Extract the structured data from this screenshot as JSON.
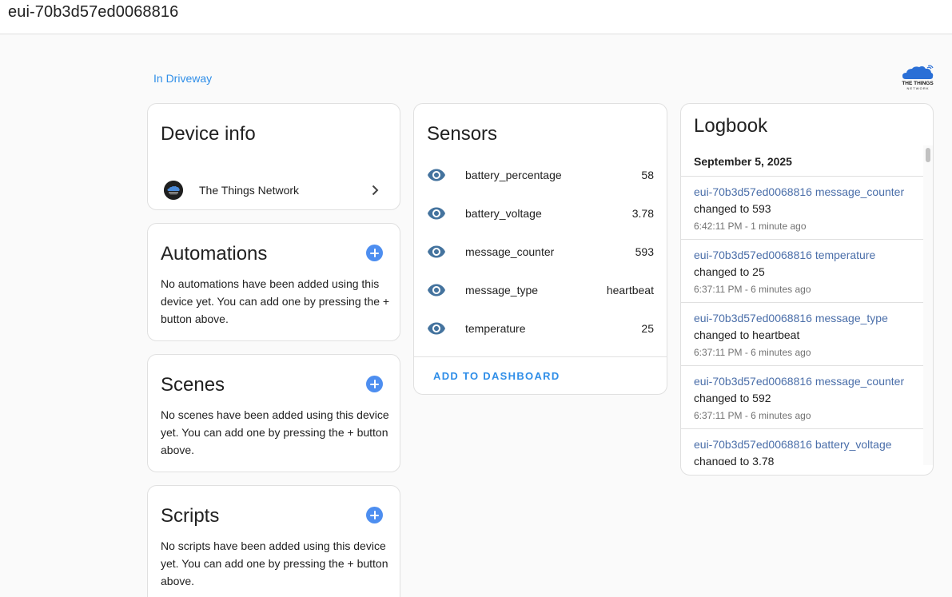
{
  "header": {
    "title": "eui-70b3d57ed0068816"
  },
  "area": {
    "label": "In Driveway"
  },
  "logo": {
    "lines": [
      "THE THINGS",
      "N E T W O R K"
    ],
    "color": "#2a6fd6"
  },
  "device_info": {
    "title": "Device info",
    "integration": "The Things Network"
  },
  "automations": {
    "title": "Automations",
    "text": "No automations have been added using this device yet. You can add one by pressing the + button above."
  },
  "scenes": {
    "title": "Scenes",
    "text": "No scenes have been added using this device yet. You can add one by pressing the + button above."
  },
  "scripts": {
    "title": "Scripts",
    "text": "No scripts have been added using this device yet. You can add one by pressing the + button above."
  },
  "sensors": {
    "title": "Sensors",
    "items": [
      {
        "label": "battery_percentage",
        "value": "58"
      },
      {
        "label": "battery_voltage",
        "value": "3.78"
      },
      {
        "label": "message_counter",
        "value": "593"
      },
      {
        "label": "message_type",
        "value": "heartbeat"
      },
      {
        "label": "temperature",
        "value": "25"
      }
    ],
    "add_to_dashboard": "ADD TO DASHBOARD",
    "icon_color": "#44739e"
  },
  "logbook": {
    "title": "Logbook",
    "date": "September 5, 2025",
    "entries": [
      {
        "entity": "eui-70b3d57ed0068816 message_counter",
        "message": "changed to 593",
        "time": "6:42:11 PM - 1 minute ago"
      },
      {
        "entity": "eui-70b3d57ed0068816 temperature",
        "message": "changed to 25",
        "time": "6:37:11 PM - 6 minutes ago"
      },
      {
        "entity": "eui-70b3d57ed0068816 message_type",
        "message": "changed to heartbeat",
        "time": "6:37:11 PM - 6 minutes ago"
      },
      {
        "entity": "eui-70b3d57ed0068816 message_counter",
        "message": "changed to 592",
        "time": "6:37:11 PM - 6 minutes ago"
      },
      {
        "entity": "eui-70b3d57ed0068816 battery_voltage",
        "message": "changed to 3.78",
        "time": ""
      }
    ]
  }
}
